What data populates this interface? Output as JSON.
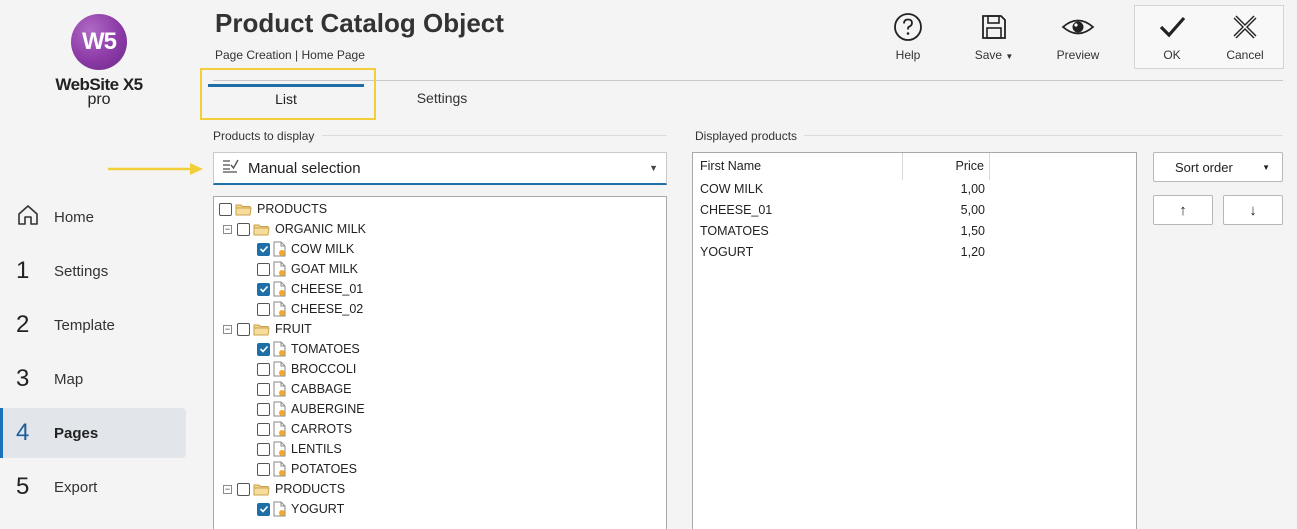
{
  "brand": {
    "mark": "W5",
    "name": "WebSite X5",
    "edition": "pro"
  },
  "nav": [
    {
      "num": "",
      "label": "Home",
      "icon": "home-icon"
    },
    {
      "num": "1",
      "label": "Settings"
    },
    {
      "num": "2",
      "label": "Template"
    },
    {
      "num": "3",
      "label": "Map"
    },
    {
      "num": "4",
      "label": "Pages",
      "active": true
    },
    {
      "num": "5",
      "label": "Export"
    }
  ],
  "header": {
    "title": "Product Catalog Object",
    "breadcrumb": "Page Creation | Home Page"
  },
  "toolbar": {
    "help": "Help",
    "save": "Save",
    "preview": "Preview",
    "ok": "OK",
    "cancel": "Cancel"
  },
  "tabs": [
    {
      "label": "List",
      "active": true
    },
    {
      "label": "Settings"
    }
  ],
  "products_panel": {
    "label": "Products to display",
    "selection": "Manual selection"
  },
  "tree": [
    {
      "label": "PRODUCTS",
      "type": "folder",
      "level": 0,
      "checked": false,
      "expander": false
    },
    {
      "label": "ORGANIC MILK",
      "type": "folder",
      "level": 1,
      "checked": false,
      "expander": true
    },
    {
      "label": "COW MILK",
      "type": "item",
      "level": 2,
      "checked": true
    },
    {
      "label": "GOAT MILK",
      "type": "item",
      "level": 2,
      "checked": false
    },
    {
      "label": "CHEESE_01",
      "type": "item",
      "level": 2,
      "checked": true
    },
    {
      "label": "CHEESE_02",
      "type": "item",
      "level": 2,
      "checked": false
    },
    {
      "label": "FRUIT",
      "type": "folder",
      "level": 1,
      "checked": false,
      "expander": true
    },
    {
      "label": "TOMATOES",
      "type": "item",
      "level": 2,
      "checked": true
    },
    {
      "label": "BROCCOLI",
      "type": "item",
      "level": 2,
      "checked": false
    },
    {
      "label": "CABBAGE",
      "type": "item",
      "level": 2,
      "checked": false
    },
    {
      "label": "AUBERGINE",
      "type": "item",
      "level": 2,
      "checked": false
    },
    {
      "label": "CARROTS",
      "type": "item",
      "level": 2,
      "checked": false
    },
    {
      "label": "LENTILS",
      "type": "item",
      "level": 2,
      "checked": false
    },
    {
      "label": "POTATOES",
      "type": "item",
      "level": 2,
      "checked": false
    },
    {
      "label": "PRODUCTS",
      "type": "folder",
      "level": 1,
      "checked": false,
      "expander": true
    },
    {
      "label": "YOGURT",
      "type": "item",
      "level": 2,
      "checked": true
    }
  ],
  "displayed": {
    "label": "Displayed products",
    "columns": {
      "name": "First Name",
      "price": "Price"
    },
    "rows": [
      {
        "name": "COW MILK",
        "price": "1,00"
      },
      {
        "name": "CHEESE_01",
        "price": "5,00"
      },
      {
        "name": "TOMATOES",
        "price": "1,50"
      },
      {
        "name": "YOGURT",
        "price": "1,20"
      }
    ]
  },
  "sort": {
    "label": "Sort order",
    "up": "↑",
    "down": "↓"
  },
  "colors": {
    "accent": "#1e6fa8",
    "highlight": "#f2cf3a",
    "brand": "#8c3aa6"
  }
}
